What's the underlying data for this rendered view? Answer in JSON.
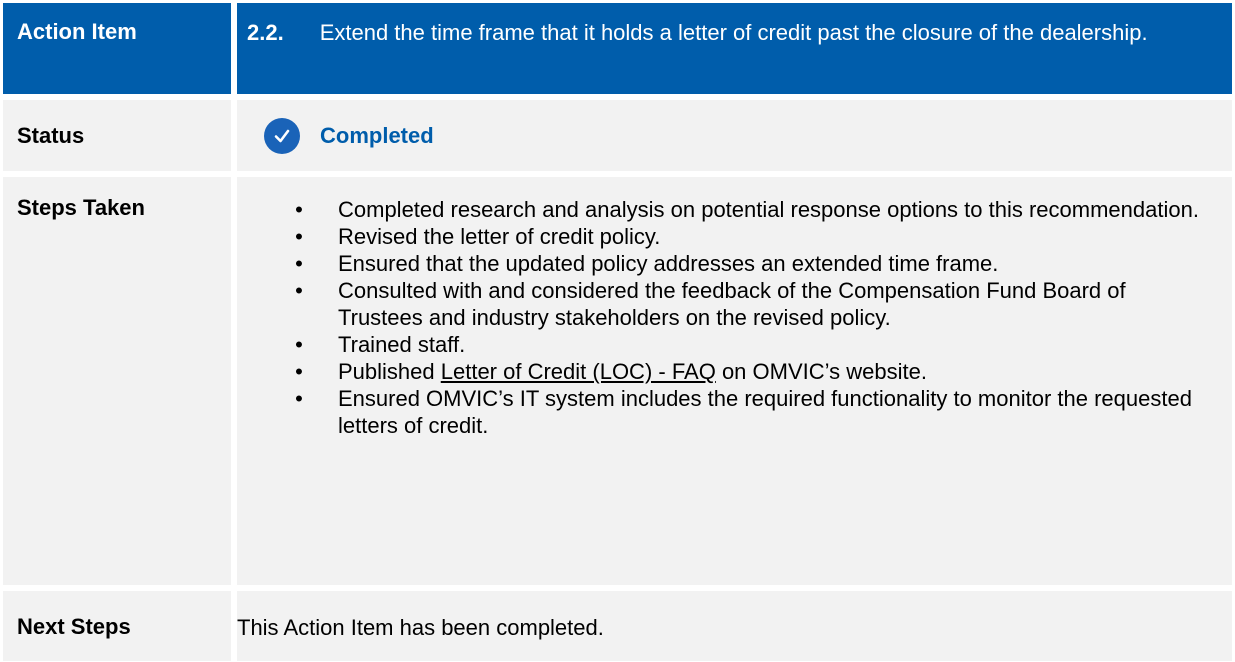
{
  "header": {
    "label": "Action Item",
    "item_number": "2.2.",
    "item_text": "Extend the time frame that it holds a letter of credit past the closure of the dealership."
  },
  "status": {
    "label": "Status",
    "icon": "checkmark-circle-icon",
    "value": "Completed",
    "accent_color": "#005dab"
  },
  "steps_taken": {
    "label": "Steps Taken",
    "bullet_glyph": "•",
    "items": [
      "Completed research and analysis on potential response options to this recommendation.",
      "Revised the letter of credit policy.",
      "Ensured that the updated policy addresses an extended time frame.",
      "Consulted with and considered the feedback of the Compensation Fund Board of Trustees and industry stakeholders on the revised policy.",
      "Trained staff.",
      {
        "before": "Published ",
        "link_text": "Letter of Credit (LOC) - FAQ",
        "after": " on OMVIC’s website."
      },
      "Ensured OMVIC’s IT system includes the required functionality to monitor the requested letters of credit."
    ]
  },
  "next_steps": {
    "label": "Next Steps",
    "text": "This Action Item has been completed."
  },
  "colors": {
    "header_bg": "#005dab",
    "cell_bg": "#f2f2f2"
  }
}
